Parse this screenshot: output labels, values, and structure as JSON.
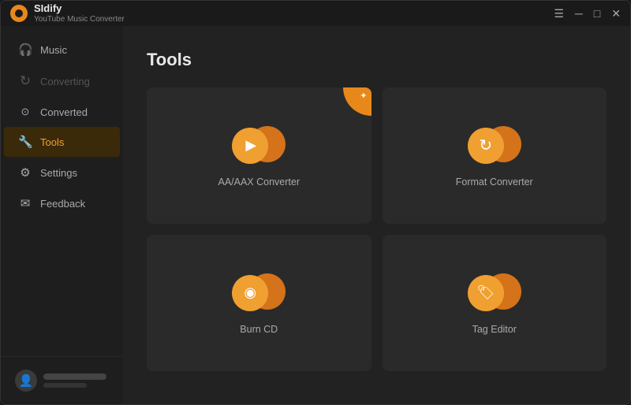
{
  "app": {
    "name": "SIdify",
    "subtitle": "YouTube Music Converter"
  },
  "titlebar": {
    "menu_icon": "☰",
    "minimize_icon": "─",
    "maximize_icon": "□",
    "close_icon": "✕"
  },
  "sidebar": {
    "items": [
      {
        "id": "music",
        "label": "Music",
        "icon": "🎧",
        "active": false,
        "disabled": false
      },
      {
        "id": "converting",
        "label": "Converting",
        "icon": "⟳",
        "active": false,
        "disabled": true
      },
      {
        "id": "converted",
        "label": "Converted",
        "icon": "⊙",
        "active": false,
        "disabled": false
      },
      {
        "id": "tools",
        "label": "Tools",
        "icon": "🔧",
        "active": true,
        "disabled": false
      },
      {
        "id": "settings",
        "label": "Settings",
        "icon": "⚙",
        "active": false,
        "disabled": false
      },
      {
        "id": "feedback",
        "label": "Feedback",
        "icon": "✉",
        "active": false,
        "disabled": false
      }
    ]
  },
  "page": {
    "title": "Tools"
  },
  "tools": [
    {
      "id": "aa-aax",
      "label": "AA/AAX Converter",
      "icon_symbol": "▶",
      "has_badge": true,
      "badge_icon": "✦"
    },
    {
      "id": "format-converter",
      "label": "Format Converter",
      "icon_symbol": "↻",
      "has_badge": false
    },
    {
      "id": "burn-cd",
      "label": "Burn CD",
      "icon_symbol": "◉",
      "has_badge": false
    },
    {
      "id": "tag-editor",
      "label": "Tag Editor",
      "icon_symbol": "🏷",
      "has_badge": false
    }
  ],
  "user": {
    "avatar_icon": "👤"
  }
}
